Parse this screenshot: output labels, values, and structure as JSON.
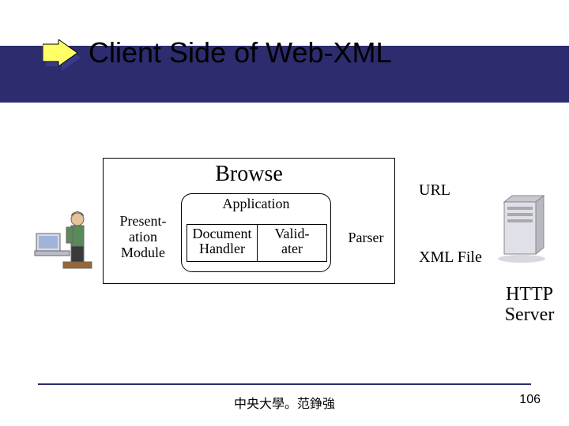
{
  "title": "Client Side of Web-XML",
  "diagram": {
    "browse_title": "Browse",
    "presentation": "Present-\nation\nModule",
    "application": "Application",
    "document_handler": "Document\nHandler",
    "validator": "Valid-\nater",
    "parser": "Parser",
    "url": "URL",
    "xml_file": "XML File",
    "server": "HTTP\nServer"
  },
  "footer": {
    "center": "中央大學。范錚強",
    "page": "106"
  },
  "icons": {
    "bullet": "arrow-right-icon",
    "user": "person-at-computer-icon",
    "server": "server-tower-icon"
  },
  "colors": {
    "band": "#2c2c6e",
    "arrow_fill": "#ffff66",
    "arrow_shadow": "#3a3a8a"
  }
}
